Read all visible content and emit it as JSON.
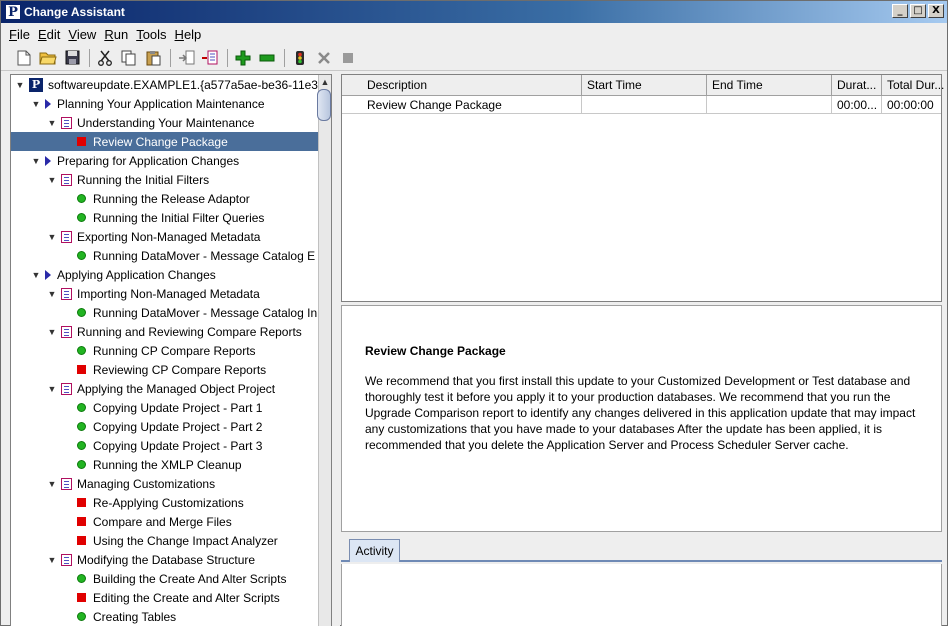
{
  "window": {
    "title": "Change Assistant",
    "app_icon_letter": "P",
    "btn_min": "_",
    "btn_max": "□",
    "btn_close": "X"
  },
  "menu": [
    {
      "label": "File",
      "mnemonic": "F"
    },
    {
      "label": "Edit",
      "mnemonic": "E"
    },
    {
      "label": "View",
      "mnemonic": "V"
    },
    {
      "label": "Run",
      "mnemonic": "R"
    },
    {
      "label": "Tools",
      "mnemonic": "T"
    },
    {
      "label": "Help",
      "mnemonic": "H"
    }
  ],
  "toolbar": [
    "new-icon",
    "open-folder-icon",
    "save-icon",
    "cut-icon",
    "copy-icon",
    "paste-icon",
    "import-icon",
    "export-icon",
    "add-step-icon",
    "remove-step-icon",
    "run-icon",
    "stop-icon",
    "pause-icon"
  ],
  "tree": [
    {
      "label": "softwareupdate.EXAMPLE1.{a577a5ae-be36-11e3",
      "level": 0,
      "icon": "root",
      "toggle": "▼"
    },
    {
      "label": "Planning Your Application Maintenance",
      "level": 1,
      "icon": "chapter",
      "toggle": "▼"
    },
    {
      "label": "Understanding Your Maintenance",
      "level": 2,
      "icon": "task",
      "toggle": "▼"
    },
    {
      "label": "Review Change Package",
      "level": 3,
      "icon": "manual",
      "toggle": "",
      "selected": true
    },
    {
      "label": "Preparing for Application Changes",
      "level": 1,
      "icon": "chapter",
      "toggle": "▼"
    },
    {
      "label": "Running the Initial Filters",
      "level": 2,
      "icon": "task",
      "toggle": "▼"
    },
    {
      "label": "Running the Release Adaptor",
      "level": 3,
      "icon": "auto",
      "toggle": ""
    },
    {
      "label": "Running the Initial Filter Queries",
      "level": 3,
      "icon": "auto",
      "toggle": ""
    },
    {
      "label": "Exporting Non-Managed Metadata",
      "level": 2,
      "icon": "task",
      "toggle": "▼"
    },
    {
      "label": "Running DataMover - Message Catalog E",
      "level": 3,
      "icon": "auto",
      "toggle": ""
    },
    {
      "label": "Applying Application Changes",
      "level": 1,
      "icon": "chapter",
      "toggle": "▼"
    },
    {
      "label": "Importing Non-Managed Metadata",
      "level": 2,
      "icon": "task",
      "toggle": "▼"
    },
    {
      "label": "Running DataMover - Message Catalog In",
      "level": 3,
      "icon": "auto",
      "toggle": ""
    },
    {
      "label": "Running and Reviewing Compare Reports",
      "level": 2,
      "icon": "task",
      "toggle": "▼"
    },
    {
      "label": "Running CP Compare Reports",
      "level": 3,
      "icon": "auto",
      "toggle": ""
    },
    {
      "label": "Reviewing CP Compare Reports",
      "level": 3,
      "icon": "manual",
      "toggle": ""
    },
    {
      "label": "Applying the Managed Object Project",
      "level": 2,
      "icon": "task",
      "toggle": "▼"
    },
    {
      "label": "Copying Update Project - Part 1",
      "level": 3,
      "icon": "auto",
      "toggle": ""
    },
    {
      "label": "Copying Update Project - Part 2",
      "level": 3,
      "icon": "auto",
      "toggle": ""
    },
    {
      "label": "Copying Update Project - Part 3",
      "level": 3,
      "icon": "auto",
      "toggle": ""
    },
    {
      "label": "Running the XMLP Cleanup",
      "level": 3,
      "icon": "auto",
      "toggle": ""
    },
    {
      "label": "Managing Customizations",
      "level": 2,
      "icon": "task",
      "toggle": "▼"
    },
    {
      "label": "Re-Applying Customizations",
      "level": 3,
      "icon": "manual",
      "toggle": ""
    },
    {
      "label": "Compare and Merge Files",
      "level": 3,
      "icon": "manual",
      "toggle": ""
    },
    {
      "label": "Using the Change Impact Analyzer",
      "level": 3,
      "icon": "manual",
      "toggle": ""
    },
    {
      "label": "Modifying the Database Structure",
      "level": 2,
      "icon": "task",
      "toggle": "▼"
    },
    {
      "label": "Building the Create And Alter Scripts",
      "level": 3,
      "icon": "auto",
      "toggle": ""
    },
    {
      "label": "Editing the Create and Alter Scripts",
      "level": 3,
      "icon": "manual",
      "toggle": ""
    },
    {
      "label": "Creating Tables",
      "level": 3,
      "icon": "auto",
      "toggle": ""
    }
  ],
  "table": {
    "columns": [
      "Description",
      "Start Time",
      "End Time",
      "Durat...",
      "Total Dur..."
    ],
    "rows": [
      [
        "Review Change Package",
        "",
        "",
        "00:00...",
        "00:00:00"
      ]
    ]
  },
  "details": {
    "title": "Review Change Package",
    "body": "We recommend that you first install this update to your Customized Development or Test database and thoroughly test it before you apply it to your production databases. We recommend that you run the Upgrade Comparison report to identify any changes delivered in this application update that may impact any customizations that you have made to your databases After the update has been applied, it is recommended that you delete the Application Server and Process Scheduler Server cache."
  },
  "tabs": [
    {
      "label": "Activity"
    }
  ],
  "colors": {
    "selection": "#4a6e9a",
    "manual_step": "#e00000",
    "auto_step": "#22b422",
    "title_bar": "#0a246a"
  }
}
